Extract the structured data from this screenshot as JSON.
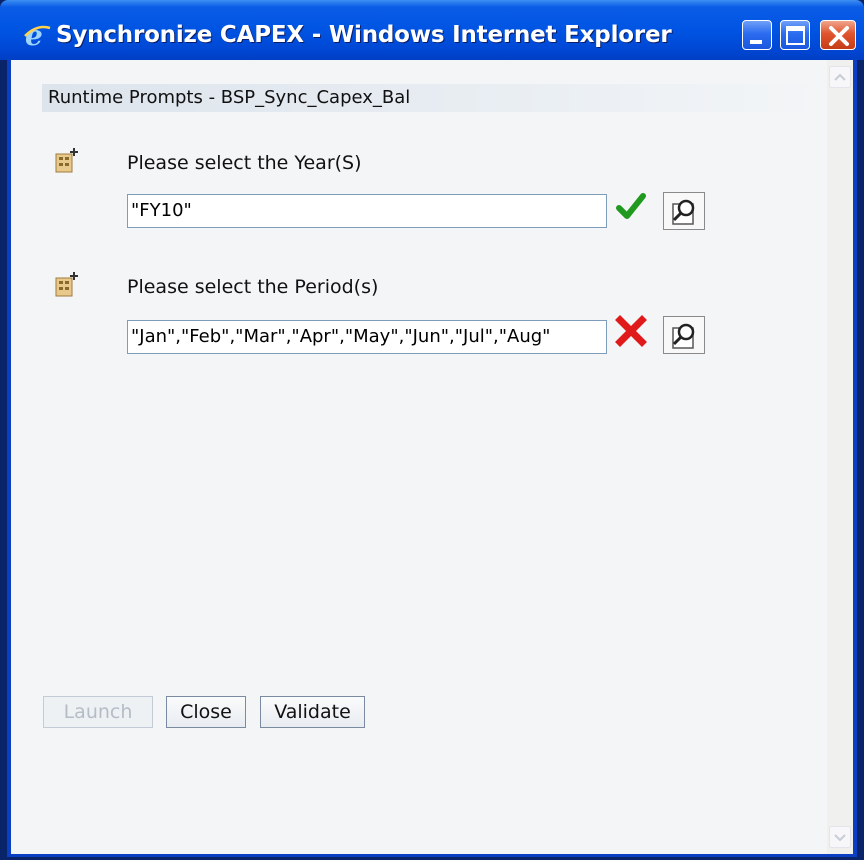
{
  "window": {
    "title": "Synchronize CAPEX - Windows Internet Explorer"
  },
  "header": {
    "title": "Runtime Prompts - BSP_Sync_Capex_Bal"
  },
  "prompts": [
    {
      "label": "Please select the Year(S)",
      "value": "\"FY10\"",
      "status": "valid",
      "status_icon": "green-check-icon",
      "status_color": "#1f9a1f"
    },
    {
      "label": "Please select the Period(s)",
      "value": "\"Jan\",\"Feb\",\"Mar\",\"Apr\",\"May\",\"Jun\",\"Jul\",\"Aug\"",
      "status": "invalid",
      "status_icon": "red-x-icon",
      "status_color": "#e01a1a"
    }
  ],
  "buttons": {
    "launch": "Launch",
    "close": "Close",
    "validate": "Validate"
  },
  "colors": {
    "titlebar": "#0054e3",
    "client_bg": "#f4f5f6",
    "input_border": "#7f9db9"
  }
}
